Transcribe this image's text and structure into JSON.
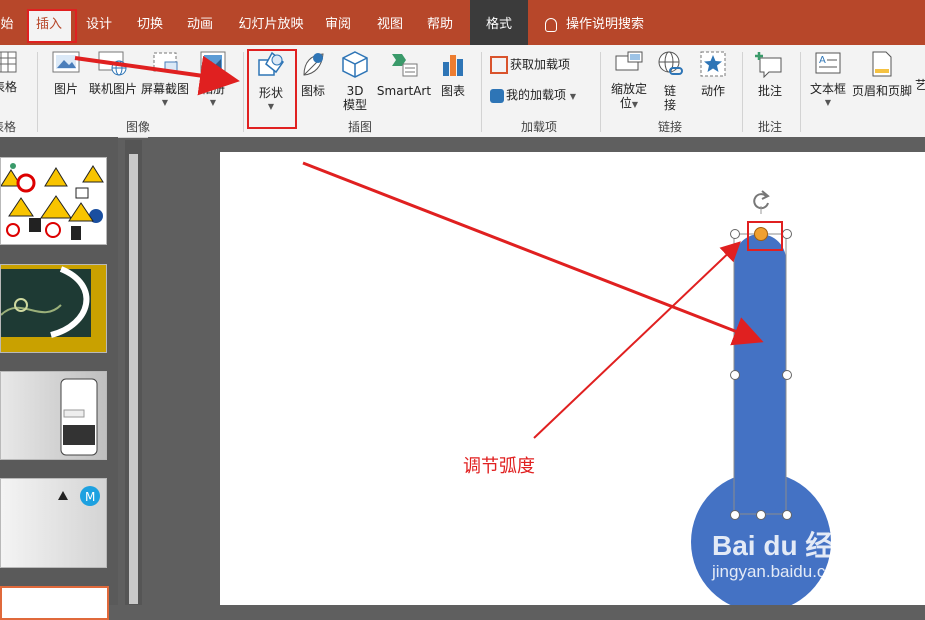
{
  "tabs": [
    {
      "label": "始"
    },
    {
      "label": "插入"
    },
    {
      "label": "设计"
    },
    {
      "label": "切换"
    },
    {
      "label": "动画"
    },
    {
      "label": "幻灯片放映"
    },
    {
      "label": "审阅"
    },
    {
      "label": "视图"
    },
    {
      "label": "帮助"
    },
    {
      "label": "格式"
    }
  ],
  "search_label": "操作说明搜索",
  "ribbon": {
    "table_label": "表格",
    "picture": "图片",
    "online_picture": "联机图片",
    "screenshot": "屏幕截图",
    "album": "相册",
    "shapes": "形状",
    "icons": "图标",
    "model_3d": "3D\n模型",
    "model_3d_a": "3D",
    "model_3d_b": "模型",
    "smartart": "SmartArt",
    "chart": "图表",
    "get_addins": "获取加载项",
    "my_addins": "我的加载项",
    "zoom_a": "缩放定",
    "zoom_b": "位",
    "link_a": "链",
    "link_b": "接",
    "action": "动作",
    "comment": "批注",
    "textbox": "文本框",
    "header_footer": "页眉和页脚",
    "overflow": "艺"
  },
  "groups": {
    "tables": "表格",
    "images": "图像",
    "illustrations": "插图",
    "addins": "加载项",
    "links": "链接",
    "comments": "批注"
  },
  "annotation": "调节弧度",
  "watermark": {
    "brand": "Bai du 经验",
    "url": "jingyan.baidu.com"
  },
  "colors": {
    "accent": "#b7472a",
    "shape": "#4472c4",
    "annotation": "#e02020"
  }
}
